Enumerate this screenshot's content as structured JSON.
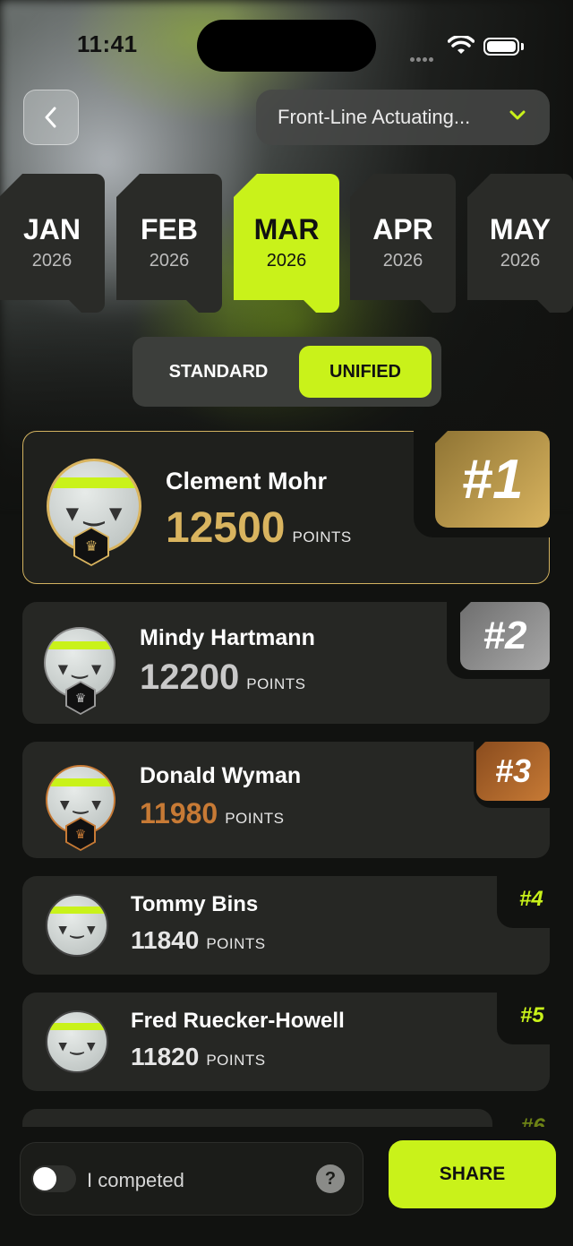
{
  "status_bar": {
    "time": "11:41"
  },
  "header": {
    "dropdown_value": "Front-Line Actuating..."
  },
  "months": [
    {
      "month": "JAN",
      "year": "2026",
      "active": false
    },
    {
      "month": "FEB",
      "year": "2026",
      "active": false
    },
    {
      "month": "MAR",
      "year": "2026",
      "active": true
    },
    {
      "month": "APR",
      "year": "2026",
      "active": false
    },
    {
      "month": "MAY",
      "year": "2026",
      "active": false
    }
  ],
  "mode_toggle": {
    "standard": "STANDARD",
    "unified": "UNIFIED",
    "selected": "UNIFIED"
  },
  "points_label": "POINTS",
  "leaderboard": [
    {
      "rank": "#1",
      "name": "Clement Mohr",
      "points": "12500",
      "color": "#d9b45f"
    },
    {
      "rank": "#2",
      "name": "Mindy Hartmann",
      "points": "12200",
      "color": "#c9c9c9"
    },
    {
      "rank": "#3",
      "name": "Donald Wyman",
      "points": "11980",
      "color": "#c77a35"
    },
    {
      "rank": "#4",
      "name": "Tommy Bins",
      "points": "11840",
      "color": "#e6e6e6"
    },
    {
      "rank": "#5",
      "name": "Fred Ruecker-Howell",
      "points": "11820",
      "color": "#e6e6e6"
    },
    {
      "rank": "#6"
    }
  ],
  "footer": {
    "competed_label": "I competed",
    "competed_on": false,
    "help": "?",
    "share": "SHARE"
  },
  "colors": {
    "accent": "#c9f21a",
    "gold": "#d9b45f",
    "silver": "#9a9a9a",
    "bronze": "#c77a35"
  }
}
